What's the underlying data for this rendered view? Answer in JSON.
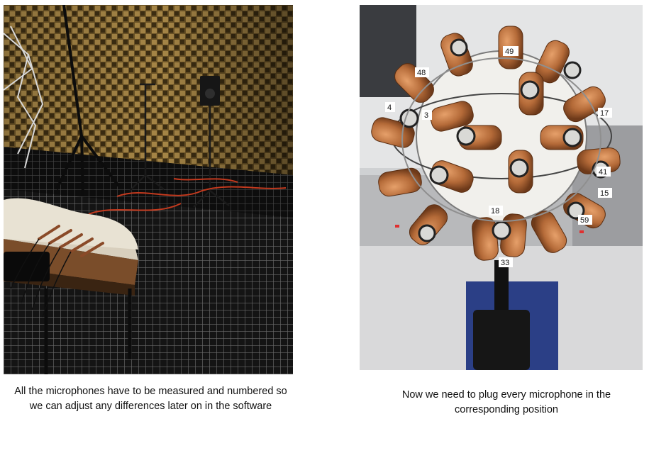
{
  "images": [
    {
      "subject": "anechoic-chamber-with-microphone-stands",
      "caption": "All the microphones have to be measured and numbered so we can adjust any differences later on in the software"
    },
    {
      "subject": "spherical-microphone-array",
      "caption": "Now we need to plug every microphone in the corresponding position",
      "capsule_labels": [
        "49",
        "48",
        "4",
        "3",
        "17",
        "41",
        "15",
        "18",
        "59",
        "33"
      ]
    }
  ]
}
